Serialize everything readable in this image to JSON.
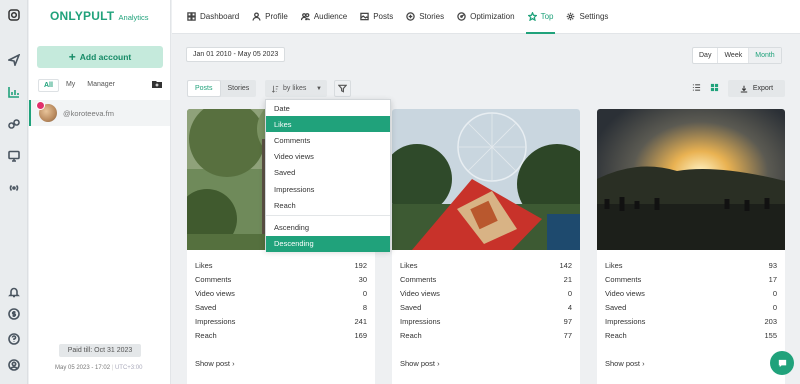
{
  "brand": {
    "name": "ONLYPULT",
    "sub": "Analytics"
  },
  "sidebar": {
    "add_account": "Add account",
    "filter_tabs": [
      "All",
      "My",
      "Manager"
    ],
    "account_handle": "@koroteeva.fm",
    "paid_till": "Paid till: Oct 31 2023",
    "footer_date": "May 05 2023 - 17:02",
    "footer_tz": "UTC+3:00"
  },
  "nav": {
    "items": [
      {
        "label": "Dashboard",
        "icon": "dashboard-icon"
      },
      {
        "label": "Profile",
        "icon": "user-icon"
      },
      {
        "label": "Audience",
        "icon": "audience-icon"
      },
      {
        "label": "Posts",
        "icon": "posts-icon"
      },
      {
        "label": "Stories",
        "icon": "stories-icon"
      },
      {
        "label": "Optimization",
        "icon": "optimization-icon"
      },
      {
        "label": "Top",
        "icon": "star-icon"
      },
      {
        "label": "Settings",
        "icon": "gear-icon"
      }
    ],
    "active": "Top"
  },
  "toolbar": {
    "date_range": "Jan 01 2010 - May 05 2023",
    "periods": [
      "Day",
      "Week",
      "Month"
    ],
    "active_period": "Month",
    "types": [
      "Posts",
      "Stories"
    ],
    "active_type": "Posts",
    "sort_label": "by likes",
    "export_label": "Export"
  },
  "dropdown": {
    "sort_options": [
      "Date",
      "Likes",
      "Comments",
      "Video views",
      "Saved",
      "Impressions",
      "Reach"
    ],
    "order_options": [
      "Ascending",
      "Descending"
    ],
    "selected_sort": "Likes",
    "selected_order": "Descending"
  },
  "cards": [
    {
      "stats": [
        {
          "label": "Likes",
          "value": "192"
        },
        {
          "label": "Comments",
          "value": "30"
        },
        {
          "label": "Video views",
          "value": "0"
        },
        {
          "label": "Saved",
          "value": "8"
        },
        {
          "label": "Impressions",
          "value": "241"
        },
        {
          "label": "Reach",
          "value": "169"
        }
      ],
      "show_post": "Show post"
    },
    {
      "stats": [
        {
          "label": "Likes",
          "value": "142"
        },
        {
          "label": "Comments",
          "value": "21"
        },
        {
          "label": "Video views",
          "value": "0"
        },
        {
          "label": "Saved",
          "value": "4"
        },
        {
          "label": "Impressions",
          "value": "97"
        },
        {
          "label": "Reach",
          "value": "77"
        }
      ],
      "show_post": "Show post"
    },
    {
      "stats": [
        {
          "label": "Likes",
          "value": "93"
        },
        {
          "label": "Comments",
          "value": "17"
        },
        {
          "label": "Video views",
          "value": "0"
        },
        {
          "label": "Saved",
          "value": "0"
        },
        {
          "label": "Impressions",
          "value": "203"
        },
        {
          "label": "Reach",
          "value": "155"
        }
      ],
      "show_post": "Show post"
    }
  ],
  "colors": {
    "accent": "#20a27b",
    "accent_light": "#c5eadc",
    "background": "#eef0f2"
  }
}
